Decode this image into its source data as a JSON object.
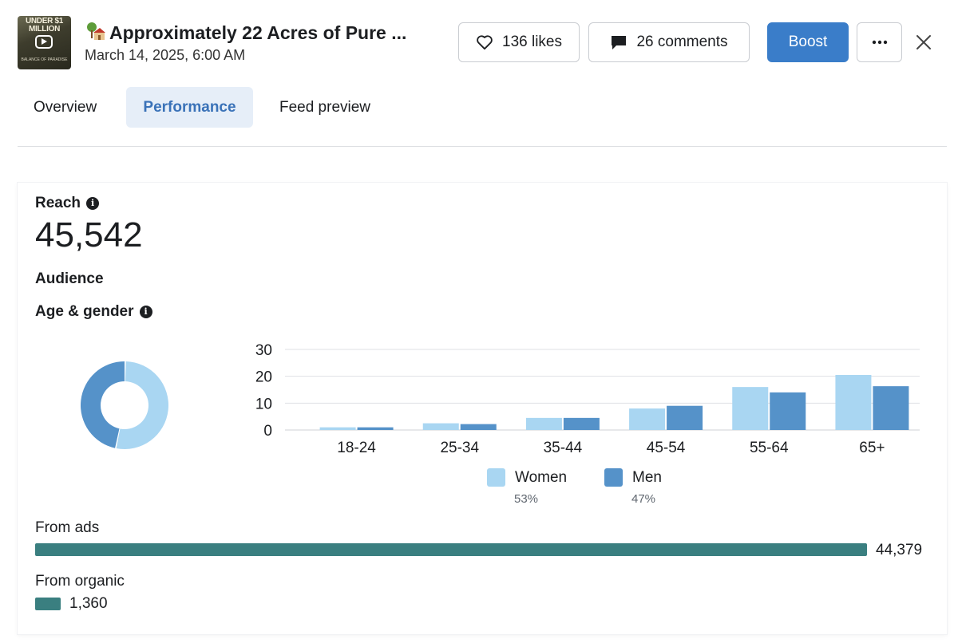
{
  "post": {
    "thumbnail_text": "UNDER $1 MILLION",
    "thumbnail_subtext": "BALANCE OF PARADISE",
    "title": "Approximately 22 Acres of Pure ...",
    "date": "March 14, 2025, 6:00 AM"
  },
  "actions": {
    "likes": "136 likes",
    "comments": "26 comments",
    "boost": "Boost"
  },
  "tabs": [
    {
      "label": "Overview",
      "active": false
    },
    {
      "label": "Performance",
      "active": true
    },
    {
      "label": "Feed preview",
      "active": false
    }
  ],
  "reach": {
    "label": "Reach",
    "value": "45,542"
  },
  "audience": {
    "label": "Audience",
    "age_gender_label": "Age & gender"
  },
  "colors": {
    "women": "#a9d6f2",
    "men": "#5592c9",
    "source_bar": "#3a7f80",
    "boost": "#3a7dc9"
  },
  "chart_data": {
    "type": "bar",
    "categories": [
      "18-24",
      "25-34",
      "35-44",
      "45-54",
      "55-64",
      "65+"
    ],
    "series": [
      {
        "name": "Women",
        "values": [
          1,
          2.5,
          4.5,
          8,
          16,
          20.5
        ]
      },
      {
        "name": "Men",
        "values": [
          1,
          2.2,
          4.5,
          9,
          14,
          16.3
        ]
      }
    ],
    "yticks": [
      0,
      10,
      20,
      30
    ],
    "ylim": [
      0,
      30
    ],
    "grid": true,
    "legend": [
      {
        "name": "Women",
        "pct": "53%"
      },
      {
        "name": "Men",
        "pct": "47%"
      }
    ],
    "donut": {
      "Women": 53,
      "Men": 47
    }
  },
  "sources": {
    "ads_label": "From ads",
    "ads_value": "44,379",
    "ads_count": 44379,
    "organic_label": "From organic",
    "organic_value": "1,360",
    "organic_count": 1360
  }
}
